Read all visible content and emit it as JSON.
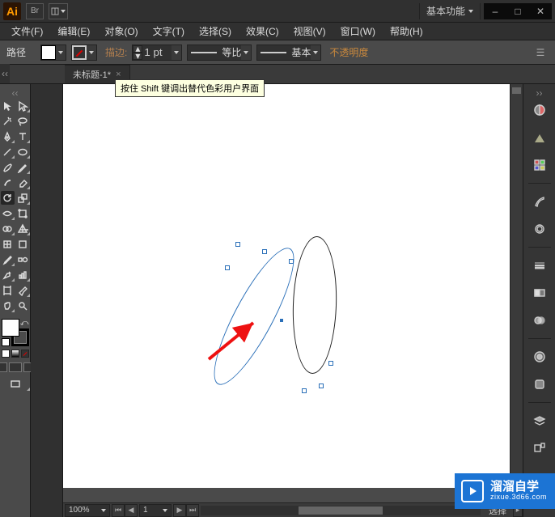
{
  "app": {
    "logo_text": "Ai",
    "bridge": "Br"
  },
  "workspace": {
    "label": "基本功能"
  },
  "window_controls": {
    "min": "–",
    "max": "□",
    "close": "✕"
  },
  "menus": {
    "file": "文件(F)",
    "edit": "编辑(E)",
    "object": "对象(O)",
    "type": "文字(T)",
    "select": "选择(S)",
    "effect": "效果(C)",
    "view": "视图(V)",
    "window": "窗口(W)",
    "help": "帮助(H)"
  },
  "control": {
    "mode_label": "路径",
    "stroke_label": "描边:",
    "stroke_pt": "1 pt",
    "profile_label": "等比",
    "style_label": "基本",
    "opacity_label": "不透明度"
  },
  "document": {
    "tab_title": "未标题-1*",
    "close_x": "×"
  },
  "tooltip": {
    "text": "按住 Shift 键调出替代色彩用户界面"
  },
  "tools": {
    "selection": "selection-tool",
    "direct": "direct-selection-tool",
    "wand": "magic-wand-tool",
    "lasso": "lasso-tool",
    "pen": "pen-tool",
    "type": "type-tool",
    "line": "line-tool",
    "rect": "rectangle-tool",
    "brush": "paintbrush-tool",
    "pencil": "pencil-tool",
    "blob": "blob-brush-tool",
    "eraser": "eraser-tool",
    "rotate": "rotate-tool",
    "scale": "scale-tool",
    "width": "width-tool",
    "free": "free-transform-tool",
    "shapeb": "shape-builder-tool",
    "persp": "perspective-tool",
    "mesh": "mesh-tool",
    "gradient": "gradient-tool",
    "eyedrop": "eyedropper-tool",
    "blend": "blend-tool",
    "symbol": "symbol-sprayer-tool",
    "graph": "column-graph-tool",
    "artb": "artboard-tool",
    "slice": "slice-tool",
    "hand": "hand-tool",
    "zoom": "zoom-tool"
  },
  "right_panels": {
    "color": "color-panel",
    "guide": "color-guide-panel",
    "swatches": "swatches-panel",
    "brushes": "brushes-panel",
    "symbols": "symbols-panel",
    "stroke_p": "stroke-panel",
    "gradient_p": "gradient-panel",
    "transparency": "transparency-panel",
    "appearance": "appearance-panel",
    "styles": "graphic-styles-panel",
    "layers": "layers-panel",
    "artboards": "artboards-panel"
  },
  "status": {
    "zoom": "100%",
    "tool": "选择"
  },
  "watermark": {
    "title": "溜溜自学",
    "url": "zixue.3d66.com"
  }
}
